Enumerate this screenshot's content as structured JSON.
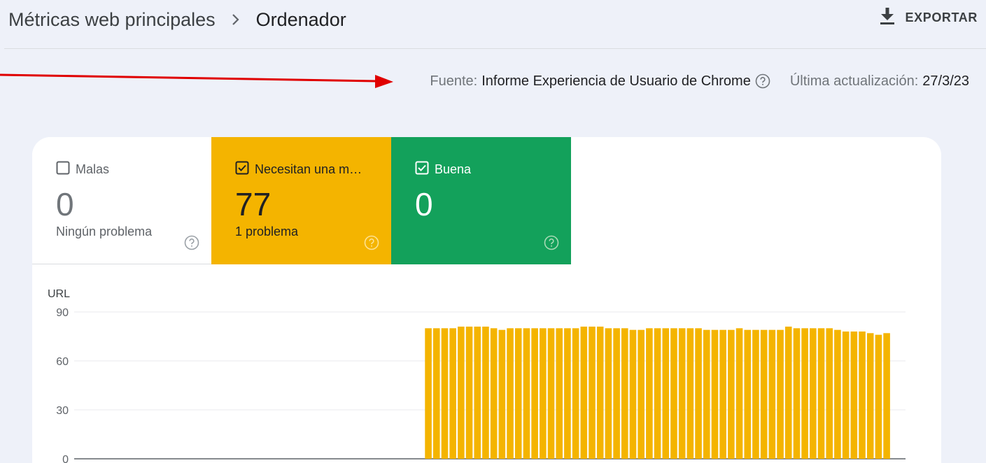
{
  "header": {
    "breadcrumb_parent": "Métricas web principales",
    "breadcrumb_current": "Ordenador",
    "export_label": "EXPORTAR"
  },
  "source_line": {
    "source_label": "Fuente:",
    "source_value": "Informe Experiencia de Usuario de Chrome",
    "updated_label": "Última actualización:",
    "updated_value": "27/3/23"
  },
  "tiles": [
    {
      "label": "Malas",
      "count": "0",
      "sub": "Ningún problema",
      "checked": false,
      "color": "#ffffff"
    },
    {
      "label": "Necesitan una m…",
      "count": "77",
      "sub": "1 problema",
      "checked": true,
      "color": "#f4b400"
    },
    {
      "label": "Buena",
      "count": "0",
      "sub": "",
      "checked": true,
      "color": "#13a15b"
    }
  ],
  "colors": {
    "needs_improvement": "#f4b400",
    "good": "#13a15b",
    "arrow": "#e00000"
  },
  "chart_data": {
    "type": "bar",
    "ylabel": "URL",
    "yticks": [
      "0",
      "30",
      "60",
      "90"
    ],
    "ylim": [
      0,
      90
    ],
    "grid": true,
    "series": [
      {
        "color": "#f4b400",
        "values": [
          0,
          0,
          0,
          0,
          0,
          0,
          0,
          0,
          0,
          0,
          0,
          0,
          0,
          0,
          0,
          0,
          0,
          0,
          0,
          0,
          0,
          0,
          0,
          0,
          0,
          0,
          0,
          0,
          0,
          0,
          0,
          0,
          0,
          0,
          0,
          0,
          0,
          0,
          0,
          0,
          0,
          0,
          80,
          80,
          80,
          80,
          81,
          81,
          81,
          81,
          80,
          79,
          80,
          80,
          80,
          80,
          80,
          80,
          80,
          80,
          80,
          81,
          81,
          81,
          80,
          80,
          80,
          79,
          79,
          80,
          80,
          80,
          80,
          80,
          80,
          80,
          79,
          79,
          79,
          79,
          80,
          79,
          79,
          79,
          79,
          79,
          81,
          80,
          80,
          80,
          80,
          80,
          79,
          78,
          78,
          78,
          77,
          76,
          77
        ]
      }
    ]
  }
}
